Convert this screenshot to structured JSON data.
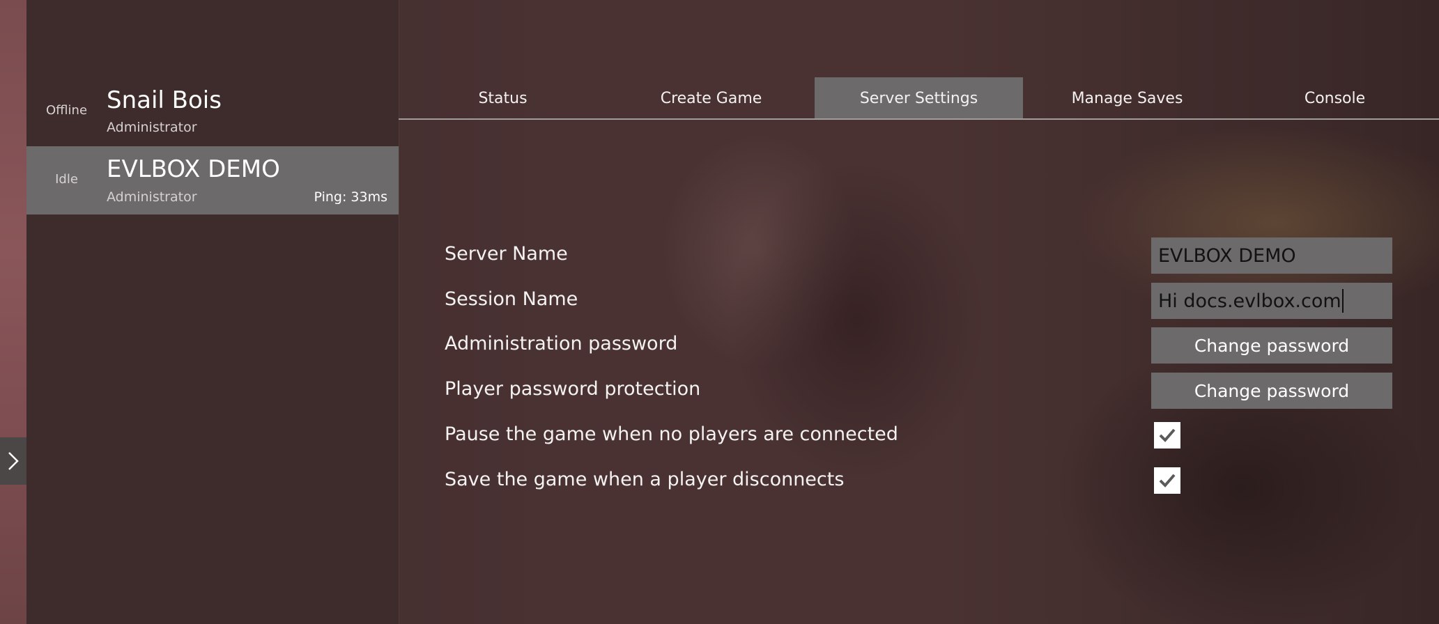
{
  "sidebar": {
    "expand_icon": "chevron-right-icon",
    "servers": [
      {
        "status": "Offline",
        "name": "Snail Bois",
        "role": "Administrator",
        "ping": ""
      },
      {
        "status": "Idle",
        "name": "EVLBOX DEMO",
        "role": "Administrator",
        "ping": "Ping: 33ms"
      }
    ]
  },
  "tabs": [
    {
      "label": "Status"
    },
    {
      "label": "Create Game"
    },
    {
      "label": "Server Settings"
    },
    {
      "label": "Manage Saves"
    },
    {
      "label": "Console"
    }
  ],
  "active_tab": "Server Settings",
  "settings": {
    "server_name": {
      "label": "Server Name",
      "value": "EVLBOX DEMO"
    },
    "session_name": {
      "label": "Session Name",
      "value": "Hi docs.evlbox.com"
    },
    "admin_password": {
      "label": "Administration password",
      "button": "Change password"
    },
    "player_password": {
      "label": "Player password protection",
      "button": "Change password"
    },
    "pause_when_empty": {
      "label": "Pause the game when no players are connected",
      "checked": true
    },
    "save_on_disconnect": {
      "label": "Save the game when a player disconnects",
      "checked": true
    }
  },
  "colors": {
    "panel_bg": "#3e2b2b",
    "selected_bg": "#6c6a6b",
    "accent_strip": "#8a5659",
    "check_mark": "#5a5a5a"
  }
}
